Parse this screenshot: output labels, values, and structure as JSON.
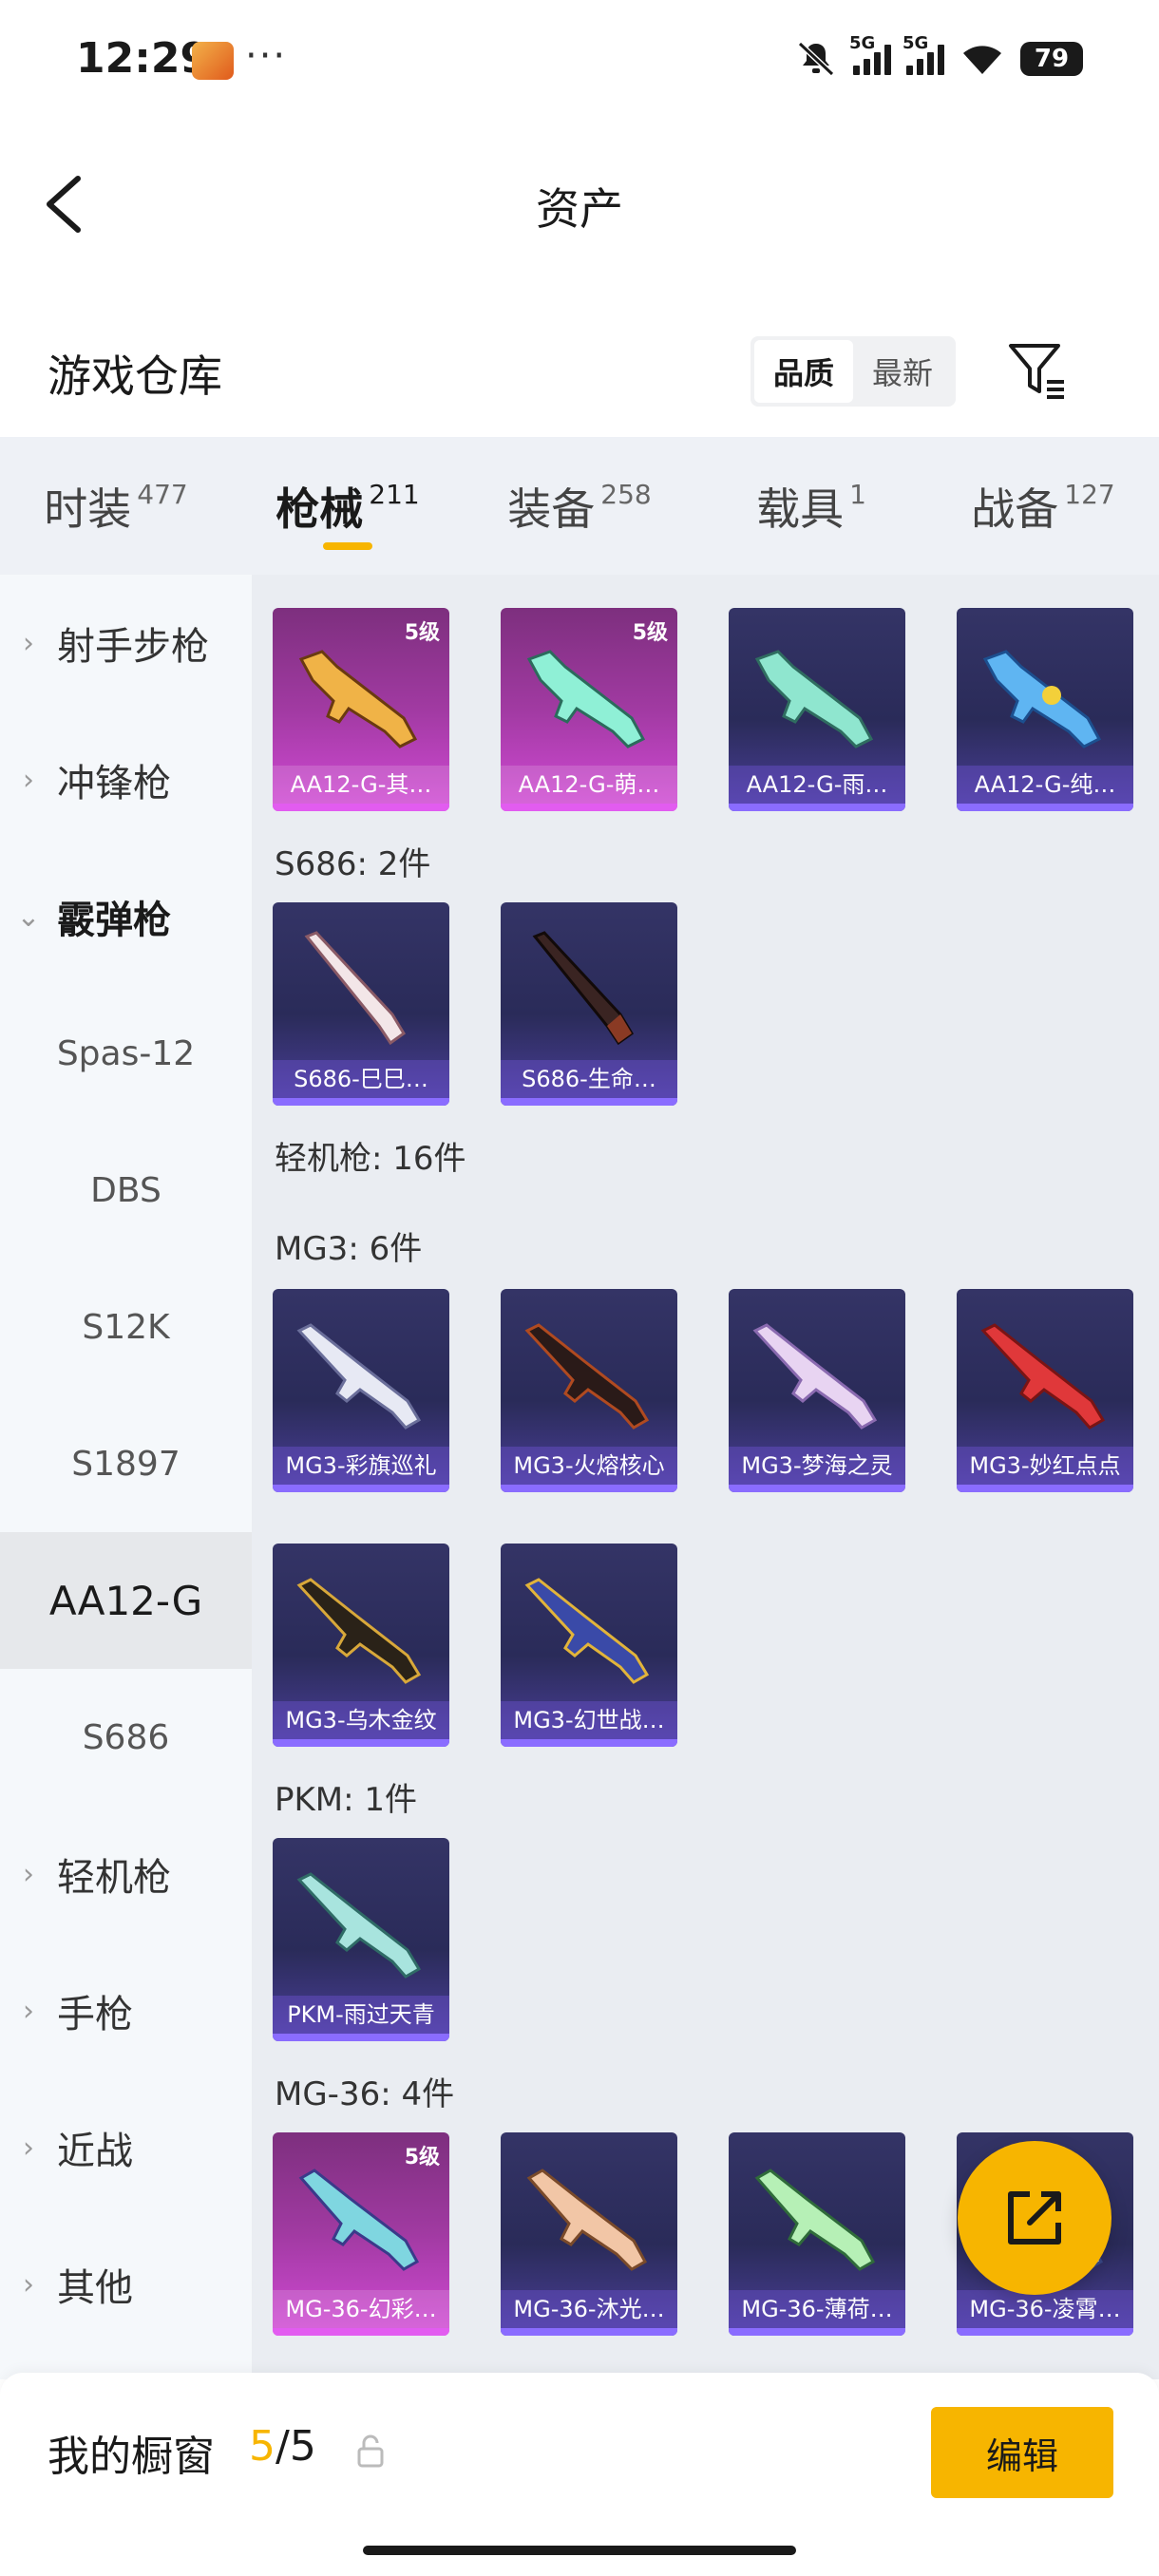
{
  "status": {
    "time": "12:29",
    "dots": "···",
    "net1": "5G",
    "net2": "5G",
    "battery": "79"
  },
  "header": {
    "title": "资产"
  },
  "section": {
    "title": "游戏仓库",
    "sort": [
      "品质",
      "最新"
    ]
  },
  "tabs": [
    {
      "label": "时装",
      "count": "477"
    },
    {
      "label": "枪械",
      "count": "211"
    },
    {
      "label": "装备",
      "count": "258"
    },
    {
      "label": "载具",
      "count": "1"
    },
    {
      "label": "战备",
      "count": "127"
    }
  ],
  "sidebar": {
    "top": [
      {
        "label": "射手步枪",
        "chev": "›"
      },
      {
        "label": "冲锋枪",
        "chev": "›"
      },
      {
        "label": "霰弹枪",
        "chev": "⌄"
      }
    ],
    "subs": [
      "Spas-12",
      "DBS",
      "S12K",
      "S1897",
      "AA12-G",
      "S686"
    ],
    "bottom": [
      {
        "label": "轻机枪",
        "chev": "›"
      },
      {
        "label": "手枪",
        "chev": "›"
      },
      {
        "label": "近战",
        "chev": "›"
      },
      {
        "label": "其他",
        "chev": "›"
      }
    ]
  },
  "content": {
    "g_s686": "S686: 2件",
    "g_lmg": "轻机枪: 16件",
    "g_mg3": "MG3: 6件",
    "g_pkm": "PKM: 1件",
    "g_mg36": "MG-36: 4件",
    "aa12": [
      {
        "name": "AA12-G-其…",
        "level": "5级"
      },
      {
        "name": "AA12-G-萌…",
        "level": "5级"
      },
      {
        "name": "AA12-G-雨…"
      },
      {
        "name": "AA12-G-纯…"
      }
    ],
    "s686": [
      {
        "name": "S686-巳巳…"
      },
      {
        "name": "S686-生命…"
      }
    ],
    "mg3": [
      {
        "name": "MG3-彩旗巡礼"
      },
      {
        "name": "MG3-火熔核心"
      },
      {
        "name": "MG3-梦海之灵"
      },
      {
        "name": "MG3-妙红点点"
      },
      {
        "name": "MG3-乌木金纹"
      },
      {
        "name": "MG3-幻世战…"
      }
    ],
    "pkm": [
      {
        "name": "PKM-雨过天青"
      }
    ],
    "mg36": [
      {
        "name": "MG-36-幻彩…",
        "level": "5级"
      },
      {
        "name": "MG-36-沐光…"
      },
      {
        "name": "MG-36-薄荷…"
      },
      {
        "name": "MG-36-凌霄…"
      }
    ]
  },
  "bottom": {
    "label": "我的橱窗",
    "count_cur": "5",
    "count_sep": "/",
    "count_max": "5",
    "edit": "编辑"
  }
}
